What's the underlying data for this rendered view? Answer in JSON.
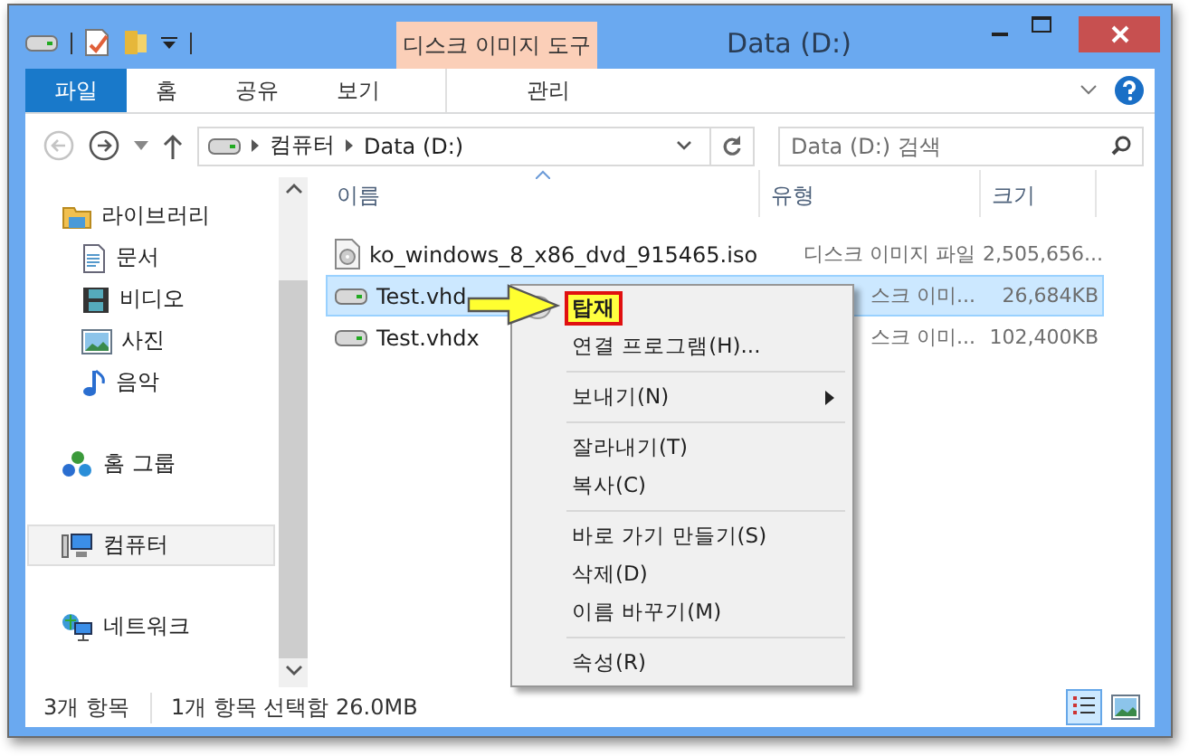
{
  "title_bar": {
    "context_tab": "디스크 이미지 도구",
    "title": "Data (D:)"
  },
  "ribbon_tabs": [
    {
      "label": "파일",
      "kind": "file",
      "selected": false
    },
    {
      "label": "홈",
      "kind": "tab",
      "selected": false
    },
    {
      "label": "공유",
      "kind": "tab",
      "selected": false
    },
    {
      "label": "보기",
      "kind": "tab",
      "selected": false
    },
    {
      "label": "관리",
      "kind": "context",
      "selected": false
    }
  ],
  "address": {
    "path": [
      "컴퓨터",
      "Data (D:)"
    ]
  },
  "search": {
    "placeholder": "Data (D:) 검색"
  },
  "nav": [
    {
      "label": "라이브러리",
      "kind": "library",
      "selected": false,
      "children": [
        {
          "label": "문서",
          "kind": "document",
          "selected": false
        },
        {
          "label": "비디오",
          "kind": "video",
          "selected": false
        },
        {
          "label": "사진",
          "kind": "picture",
          "selected": false
        },
        {
          "label": "음악",
          "kind": "music",
          "selected": false
        }
      ]
    },
    {
      "label": "홈 그룹",
      "kind": "homegroup",
      "selected": false
    },
    {
      "label": "컴퓨터",
      "kind": "computer",
      "selected": true
    },
    {
      "label": "네트워크",
      "kind": "network",
      "selected": false
    }
  ],
  "columns": [
    {
      "label": "이름",
      "sorted": true
    },
    {
      "label": "유형",
      "sorted": false
    },
    {
      "label": "크기",
      "sorted": false
    }
  ],
  "files": [
    {
      "kind": "iso",
      "name": "ko_windows_8_x86_dvd_915465.iso",
      "type": "디스크 이미지 파일",
      "size": "2,505,656...",
      "selected": false
    },
    {
      "kind": "vhd",
      "name": "Test.vhd",
      "type": "스크 이미...",
      "size": "26,684KB",
      "selected": true
    },
    {
      "kind": "vhd",
      "name": "Test.vhdx",
      "type": "스크 이미...",
      "size": "102,400KB",
      "selected": false
    }
  ],
  "status": {
    "count": "3개 항목",
    "selection": "1개 항목 선택함 26.0MB"
  },
  "views": [
    {
      "kind": "details",
      "selected": true
    },
    {
      "kind": "large-icons",
      "selected": false
    }
  ],
  "context_menu": [
    {
      "kind": "item",
      "label": "탑재",
      "default": true,
      "annotated": true,
      "submenu": false
    },
    {
      "kind": "item",
      "label": "연결 프로그램(H)...",
      "default": false,
      "annotated": false,
      "submenu": false
    },
    {
      "kind": "separator"
    },
    {
      "kind": "item",
      "label": "보내기(N)",
      "default": false,
      "annotated": false,
      "submenu": true
    },
    {
      "kind": "separator"
    },
    {
      "kind": "item",
      "label": "잘라내기(T)",
      "default": false,
      "annotated": false,
      "submenu": false
    },
    {
      "kind": "item",
      "label": "복사(C)",
      "default": false,
      "annotated": false,
      "submenu": false
    },
    {
      "kind": "separator"
    },
    {
      "kind": "item",
      "label": "바로 가기 만들기(S)",
      "default": false,
      "annotated": false,
      "submenu": false
    },
    {
      "kind": "item",
      "label": "삭제(D)",
      "default": false,
      "annotated": false,
      "submenu": false
    },
    {
      "kind": "item",
      "label": "이름 바꾸기(M)",
      "default": false,
      "annotated": false,
      "submenu": false
    },
    {
      "kind": "separator"
    },
    {
      "kind": "item",
      "label": "속성(R)",
      "default": false,
      "annotated": false,
      "submenu": false
    }
  ]
}
